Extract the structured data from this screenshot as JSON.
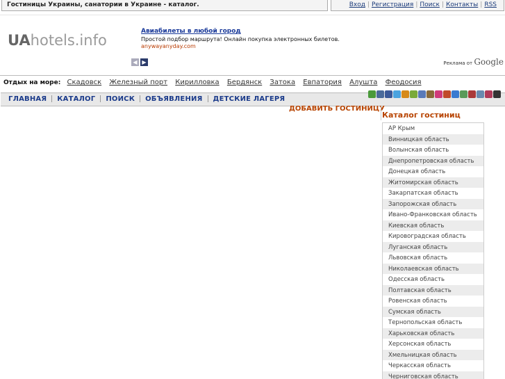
{
  "page": {
    "title": "Гостиницы Украины, санатории в Украине - каталог."
  },
  "toplinks": [
    "Вход",
    "Регистрация",
    "Поиск",
    "Контакты",
    "RSS"
  ],
  "logo": {
    "strong": "UA",
    "rest": "hotels.info"
  },
  "ad": {
    "title": "Авиабилеты в любой город",
    "text": "Простой подбор маршрута! Онлайн покупка электронных билетов.",
    "url": "anywayanyday.com",
    "google_prefix": "Реклама от",
    "google_brand": "Google"
  },
  "seabar": {
    "label": "Отдых на море:",
    "links": [
      "Скадовск",
      "Железный порт",
      "Кирилловка",
      "Бердянск",
      "Затока",
      "Евпатория",
      "Алушта",
      "Феодосия"
    ]
  },
  "social_icons": [
    {
      "name": "green-icon",
      "color": "#4a9a3a"
    },
    {
      "name": "vk-icon",
      "color": "#4a6a9a"
    },
    {
      "name": "facebook-icon",
      "color": "#3b5998"
    },
    {
      "name": "twitter-icon",
      "color": "#4aa3df"
    },
    {
      "name": "people-icon",
      "color": "#d68a1a"
    },
    {
      "name": "friends-icon",
      "color": "#7aaa3a"
    },
    {
      "name": "bookmark-icon",
      "color": "#5a7ab8"
    },
    {
      "name": "pencil-icon",
      "color": "#8a6a3a"
    },
    {
      "name": "star-icon",
      "color": "#d03a7a"
    },
    {
      "name": "mail-icon",
      "color": "#c04a2a"
    },
    {
      "name": "google-icon",
      "color": "#3a7ad0"
    },
    {
      "name": "delicious-icon",
      "color": "#5a9a5a"
    },
    {
      "name": "digg-icon",
      "color": "#aa3a3a"
    },
    {
      "name": "memori-icon",
      "color": "#6a8ab0"
    },
    {
      "name": "grid-icon",
      "color": "#b03a5a"
    },
    {
      "name": "squares-icon",
      "color": "#333333"
    }
  ],
  "nav": [
    "ГЛАВНАЯ",
    "КАТАЛОГ",
    "ПОИСК",
    "ОБЪЯВЛЕНИЯ",
    "ДЕТСКИЕ ЛАГЕРЯ"
  ],
  "add_hotel": "ДОБАВИТЬ ГОСТИНИЦУ",
  "catalog": {
    "title": "Каталог гостиниц",
    "items": [
      "АР Крым",
      "Винницкая область",
      "Волынская область",
      "Днепропетровская область",
      "Донецкая область",
      "Житомирская область",
      "Закарпатская область",
      "Запорожская область",
      "Ивано-Франковская область",
      "Киевская область",
      "Кировоградская область",
      "Луганская область",
      "Львовская область",
      "Николаевская область",
      "Одесская область",
      "Полтавская область",
      "Ровенская область",
      "Сумская область",
      "Тернопольская область",
      "Харьковская область",
      "Херсонская область",
      "Хмельницкая область",
      "Черкасская область",
      "Черниговская область"
    ]
  }
}
